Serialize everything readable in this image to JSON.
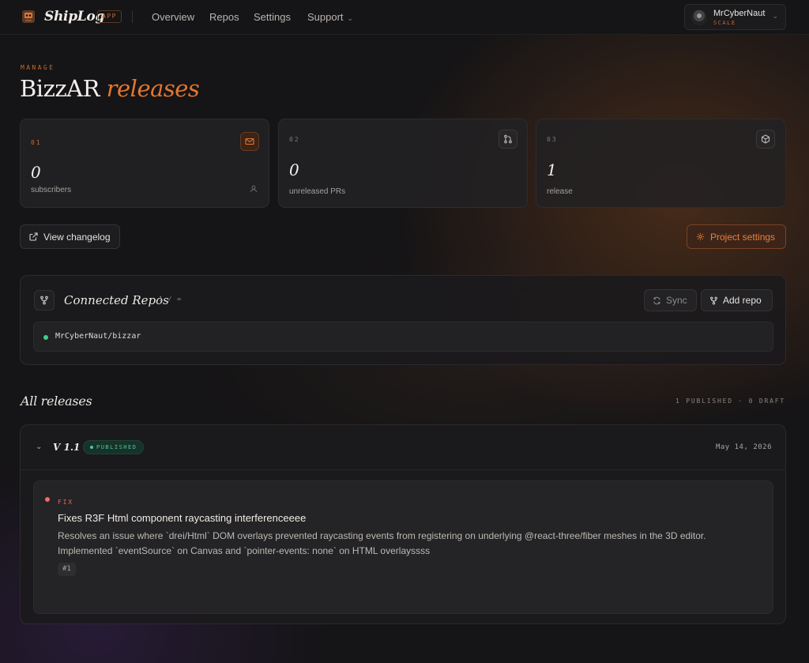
{
  "app": {
    "name": "ShipLog",
    "badge": "APP"
  },
  "nav": {
    "links": [
      "Overview",
      "Repos",
      "Settings",
      "Support"
    ]
  },
  "user": {
    "name": "MrCyberNaut",
    "plan": "SCALE"
  },
  "header": {
    "eyebrow": "MANAGE",
    "title_main": "BizzAR",
    "title_accent": "releases"
  },
  "stats": [
    {
      "index": "01",
      "value": "0",
      "label": "subscribers",
      "icon": "mail-icon"
    },
    {
      "index": "02",
      "value": "0",
      "label": "unreleased PRs",
      "icon": "git-pull-request-icon"
    },
    {
      "index": "03",
      "value": "1",
      "label": "release",
      "icon": "box-icon"
    }
  ],
  "actions": {
    "view_changelog": "View changelog",
    "project_settings": "Project settings"
  },
  "repos": {
    "title": "Connected Repos",
    "count": "1 / ∞",
    "sync_label": "Sync",
    "add_label": "Add repo",
    "items": [
      {
        "name": "MrCyberNaut/bizzar",
        "status": "connected"
      }
    ]
  },
  "releases": {
    "title": "All releases",
    "meta": "1 PUBLISHED · 0 DRAFT",
    "items": [
      {
        "version": "V 1.1",
        "status": "PUBLISHED",
        "date": "May 14, 2026",
        "entries": [
          {
            "type": "FIX",
            "title": "Fixes R3F Html component raycasting interferenceeee",
            "description": "Resolves an issue where `drei/Html` DOM overlays prevented raycasting events from registering on underlying @react-three/fiber meshes in the 3D editor. Implemented `eventSource` on Canvas and `pointer-events: none` on HTML overlayssss",
            "pr": "#1"
          }
        ]
      }
    ]
  },
  "colors": {
    "accent": "#e3772f",
    "success": "#3ecf8e",
    "fix": "#ef6b6b",
    "background": "#151416"
  }
}
